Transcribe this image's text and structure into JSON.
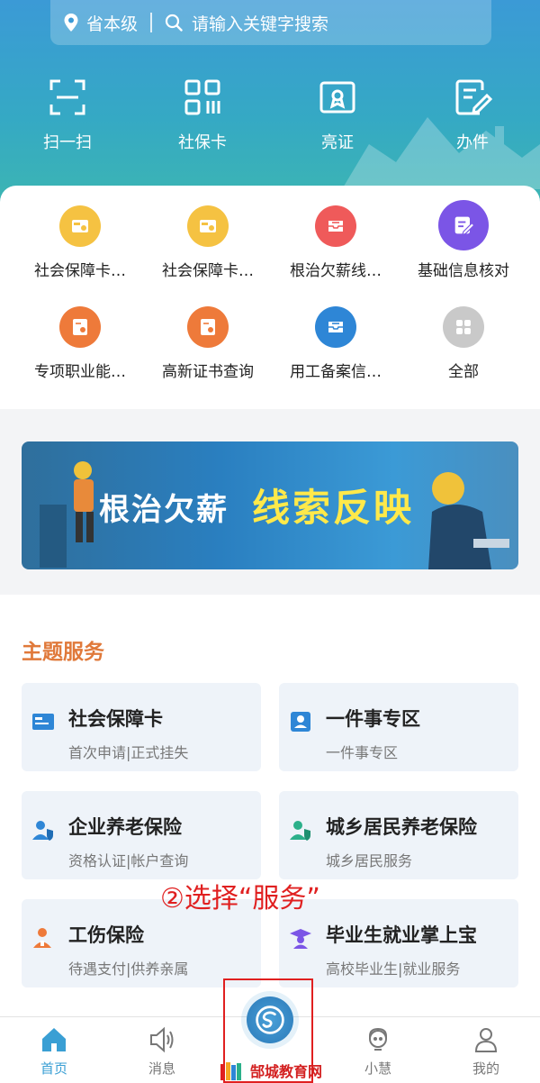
{
  "search": {
    "location": "省本级",
    "placeholder": "请输入关键字搜索"
  },
  "quick_actions": [
    {
      "label": "扫一扫",
      "icon": "scan-icon"
    },
    {
      "label": "社保卡",
      "icon": "qr-card-icon"
    },
    {
      "label": "亮证",
      "icon": "certificate-icon"
    },
    {
      "label": "办件",
      "icon": "document-edit-icon"
    }
  ],
  "services": [
    {
      "label": "社会保障卡…",
      "icon": "card-icon",
      "color": "#f5c242"
    },
    {
      "label": "社会保障卡…",
      "icon": "card-icon",
      "color": "#f5c242"
    },
    {
      "label": "根治欠薪线…",
      "icon": "inbox-icon",
      "color": "#ef5a5a"
    },
    {
      "label": "基础信息核对",
      "icon": "edit-icon",
      "color": "#7b55e6"
    },
    {
      "label": "专项职业能…",
      "icon": "certificate-icon",
      "color": "#ee7a3a"
    },
    {
      "label": "高新证书查询",
      "icon": "certificate-icon",
      "color": "#ee7a3a"
    },
    {
      "label": "用工备案信…",
      "icon": "inbox-icon",
      "color": "#2e86d6"
    },
    {
      "label": "全部",
      "icon": "grid-icon",
      "color": "#c9c9c9"
    }
  ],
  "banner": {
    "text_white": "根治欠薪",
    "text_yellow": "线索反映"
  },
  "theme": {
    "title": "主题服务",
    "tiles": [
      {
        "title": "社会保障卡",
        "subtitle": "首次申请|正式挂失",
        "icon": "card-icon"
      },
      {
        "title": "一件事专区",
        "subtitle": "一件事专区",
        "icon": "person-card-icon"
      },
      {
        "title": "企业养老保险",
        "subtitle": "资格认证|帐户查询",
        "icon": "person-shield-icon"
      },
      {
        "title": "城乡居民养老保险",
        "subtitle": "城乡居民服务",
        "icon": "person-shield-icon"
      },
      {
        "title": "工伤保险",
        "subtitle": "待遇支付|供养亲属",
        "icon": "person-injury-icon"
      },
      {
        "title": "毕业生就业掌上宝",
        "subtitle": "高校毕业生|就业服务",
        "icon": "graduate-icon"
      }
    ]
  },
  "annotation": "②选择“服务”",
  "watermark": "郜城教育网",
  "nav": [
    {
      "label": "首页",
      "icon": "home-icon"
    },
    {
      "label": "消息",
      "icon": "speaker-icon"
    },
    {
      "label": "",
      "icon": "service-icon"
    },
    {
      "label": "小慧",
      "icon": "assistant-icon"
    },
    {
      "label": "我的",
      "icon": "profile-icon"
    }
  ],
  "colors": {
    "accent": "#3a9fd4",
    "theme_title": "#e0793a",
    "banner_yellow": "#ffe94a",
    "annotation": "#e02020"
  }
}
